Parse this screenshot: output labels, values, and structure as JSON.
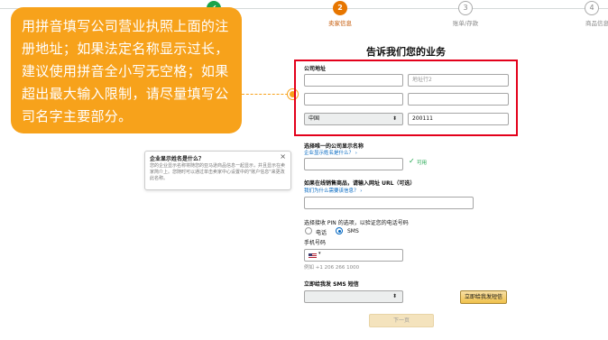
{
  "steps": [
    {
      "label": "",
      "state": "done",
      "icon": "check-icon"
    },
    {
      "num": "2",
      "label": "卖家信息",
      "state": "active"
    },
    {
      "num": "3",
      "label": "账单/存款",
      "state": "pending"
    },
    {
      "num": "4",
      "label": "商品信息",
      "state": "pending"
    }
  ],
  "callout": {
    "text": "用拼音填写公司营业执照上面的注册地址；如果法定名称显示过长，建议使用拼音全小写无空格；如果超出最大输入限制，请尽量填写公司名字主要部分。"
  },
  "page_title": "告诉我们您的业务",
  "address": {
    "label": "公司地址",
    "line2_placeholder": "地址行2",
    "country": "中国",
    "postal_code": "200111"
  },
  "tooltip": {
    "title": "企业显示姓名是什么？",
    "body": "您的企业显示名称将随您的亚马逊商品信息一起显示，并且显示在卖家简介上。您随时可以通过单击卖家中心设置中的\"账户信息\"来更改此名称。",
    "close": "×"
  },
  "display_name": {
    "label": "选择唯一的公司显示名称",
    "link": "企业显示姓名是什么？ ›",
    "status": "可用"
  },
  "website": {
    "label": "如果在线销售商品，请输入网址 URL（可选）",
    "link": "我们为什么需要该信息？ ›"
  },
  "verify": {
    "label": "选择接收 PIN 的选项，以验证您的电话号码",
    "options": [
      "电话",
      "SMS"
    ],
    "selected": "SMS",
    "phone_label": "手机号码",
    "phone_flag_caret": "▾",
    "example": "例如 +1 206 266 1000"
  },
  "sms": {
    "label": "立即给我发 SMS 短信",
    "button": "立即给我发短信"
  },
  "next_button": "下一页",
  "colors": {
    "callout": "#f7a21b",
    "highlight_box": "#e3001b",
    "active_step": "#e77600",
    "done_step": "#1aa34a",
    "link": "#0066c0"
  }
}
